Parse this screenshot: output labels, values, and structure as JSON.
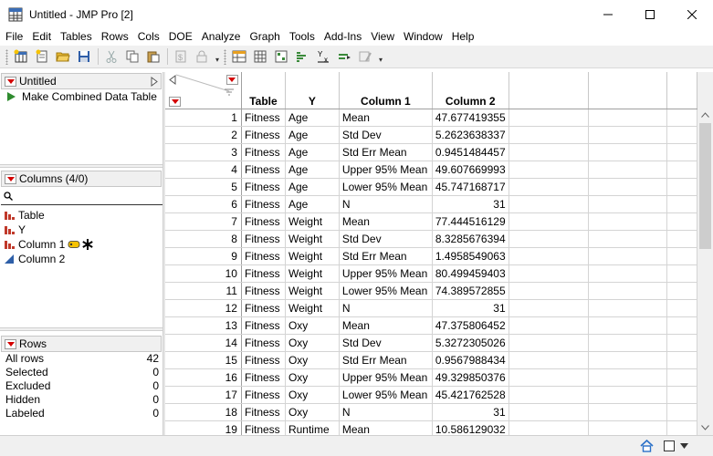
{
  "window": {
    "title": "Untitled - JMP Pro [2]",
    "icon": "jmp-table-icon",
    "controls": [
      "minimize-icon",
      "maximize-icon",
      "close-icon"
    ]
  },
  "menu": [
    "File",
    "Edit",
    "Tables",
    "Rows",
    "Cols",
    "DOE",
    "Analyze",
    "Graph",
    "Tools",
    "Add-Ins",
    "View",
    "Window",
    "Help"
  ],
  "table_panel": {
    "title": "Untitled",
    "script": "Make Combined Data Table"
  },
  "columns_panel": {
    "title": "Columns (4/0)",
    "search_icon": "search-icon",
    "items": [
      {
        "name": "Table",
        "type": "nominal"
      },
      {
        "name": "Y",
        "type": "nominal"
      },
      {
        "name": "Column 1",
        "type": "nominal"
      },
      {
        "name": "Column 2",
        "type": "continuous"
      }
    ]
  },
  "rows_panel": {
    "title": "Rows",
    "stats": [
      {
        "label": "All rows",
        "value": "42"
      },
      {
        "label": "Selected",
        "value": "0"
      },
      {
        "label": "Excluded",
        "value": "0"
      },
      {
        "label": "Hidden",
        "value": "0"
      },
      {
        "label": "Labeled",
        "value": "0"
      }
    ]
  },
  "grid": {
    "headers": [
      "Table",
      "Y",
      "Column 1",
      "Column 2"
    ],
    "rows": [
      [
        "1",
        "Fitness",
        "Age",
        "Mean",
        "47.677419355"
      ],
      [
        "2",
        "Fitness",
        "Age",
        "Std Dev",
        "5.2623638337"
      ],
      [
        "3",
        "Fitness",
        "Age",
        "Std Err Mean",
        "0.9451484457"
      ],
      [
        "4",
        "Fitness",
        "Age",
        "Upper 95% Mean",
        "49.607669993"
      ],
      [
        "5",
        "Fitness",
        "Age",
        "Lower 95% Mean",
        "45.747168717"
      ],
      [
        "6",
        "Fitness",
        "Age",
        "N",
        "31"
      ],
      [
        "7",
        "Fitness",
        "Weight",
        "Mean",
        "77.444516129"
      ],
      [
        "8",
        "Fitness",
        "Weight",
        "Std Dev",
        "8.3285676394"
      ],
      [
        "9",
        "Fitness",
        "Weight",
        "Std Err Mean",
        "1.4958549063"
      ],
      [
        "10",
        "Fitness",
        "Weight",
        "Upper 95% Mean",
        "80.499459403"
      ],
      [
        "11",
        "Fitness",
        "Weight",
        "Lower 95% Mean",
        "74.389572855"
      ],
      [
        "12",
        "Fitness",
        "Weight",
        "N",
        "31"
      ],
      [
        "13",
        "Fitness",
        "Oxy",
        "Mean",
        "47.375806452"
      ],
      [
        "14",
        "Fitness",
        "Oxy",
        "Std Dev",
        "5.3272305026"
      ],
      [
        "15",
        "Fitness",
        "Oxy",
        "Std Err Mean",
        "0.9567988434"
      ],
      [
        "16",
        "Fitness",
        "Oxy",
        "Upper 95% Mean",
        "49.329850376"
      ],
      [
        "17",
        "Fitness",
        "Oxy",
        "Lower 95% Mean",
        "45.421762528"
      ],
      [
        "18",
        "Fitness",
        "Oxy",
        "N",
        "31"
      ],
      [
        "19",
        "Fitness",
        "Runtime",
        "Mean",
        "10.586129032"
      ]
    ]
  },
  "status_icons": [
    "home-icon",
    "checkbox-icon",
    "dropdown-arrow-icon"
  ],
  "colors": {
    "red_triangle": "#d40000",
    "nominal_icon": "#c0392b",
    "continuous_icon": "#2e5fa8"
  }
}
